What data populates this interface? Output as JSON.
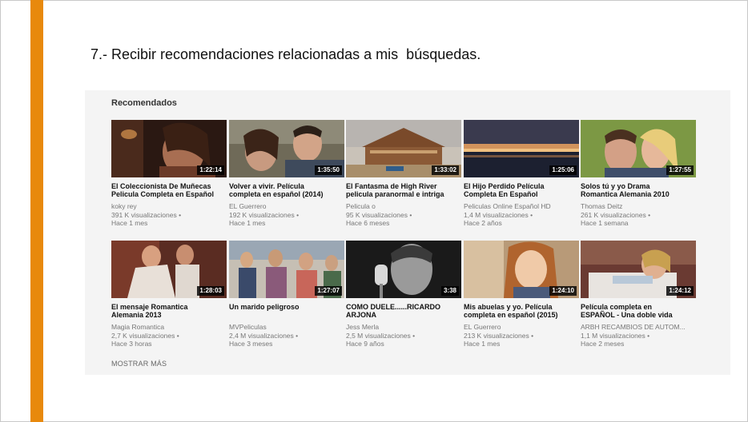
{
  "slide": {
    "title": "7.- Recibir recomendaciones relacionadas a mis  búsquedas."
  },
  "panel": {
    "section_title": "Recomendados",
    "show_more_label": "MOSTRAR MÁS",
    "videos": [
      {
        "title_line1": "El Coleccionista De Muñecas",
        "title_line2": "Pelicula Completa en Español",
        "channel": "koky rey",
        "views": "391 K visualizaciones •",
        "age": "Hace 1 mes",
        "duration": "1:22:14"
      },
      {
        "title_line1": "Volver a vivir. Película",
        "title_line2": "completa en español (2014)",
        "channel": "EL Guerrero",
        "views": "192 K visualizaciones •",
        "age": "Hace 1 mes",
        "duration": "1:35:50"
      },
      {
        "title_line1": "El Fantasma de High River",
        "title_line2": "pelicula paranormal e intriga",
        "channel": "Pelicula o",
        "views": "95 K visualizaciones •",
        "age": "Hace 6 meses",
        "duration": "1:33:02"
      },
      {
        "title_line1": "El Hijo Perdido Película",
        "title_line2": "Completa En Español",
        "channel": "Peliculas Online Español HD",
        "views": "1,4 M visualizaciones •",
        "age": "Hace 2 años",
        "duration": "1:25:06"
      },
      {
        "title_line1": "Solos tú y yo Drama",
        "title_line2": "Romantica Alemania 2010",
        "channel": "Thomas Deitz",
        "views": "261 K visualizaciones •",
        "age": "Hace 1 semana",
        "duration": "1:27:55"
      },
      {
        "title_line1": "El mensaje Romantica",
        "title_line2": "Alemania 2013",
        "channel": "Magia Romantica",
        "views": "2,7 K visualizaciones •",
        "age": "Hace 3 horas",
        "duration": "1:28:03"
      },
      {
        "title_line1": "Un marido peligroso",
        "title_line2": "",
        "channel": "MVPeliculas",
        "views": "2,4 M visualizaciones •",
        "age": "Hace 3 meses",
        "duration": "1:27:07"
      },
      {
        "title_line1": "COMO DUELE......RICARDO",
        "title_line2": "ARJONA",
        "channel": "Jess Merla",
        "views": "2,5 M visualizaciones •",
        "age": "Hace 9 años",
        "duration": "3:38"
      },
      {
        "title_line1": "Mis abuelas y yo. Película",
        "title_line2": "completa en español (2015)",
        "channel": "EL Guerrero",
        "views": "213 K visualizaciones •",
        "age": "Hace 1 mes",
        "duration": "1:24:10"
      },
      {
        "title_line1": "Película completa en",
        "title_line2": "ESPAÑOL - Una doble vida",
        "channel": "ARBH RECAMBIOS DE AUTOM...",
        "views": "1,1 M visualizaciones •",
        "age": "Hace 2 meses",
        "duration": "1:24:12"
      }
    ]
  },
  "colors": {
    "accent": "#e8890c",
    "panel_bg": "#f4f4f4"
  }
}
